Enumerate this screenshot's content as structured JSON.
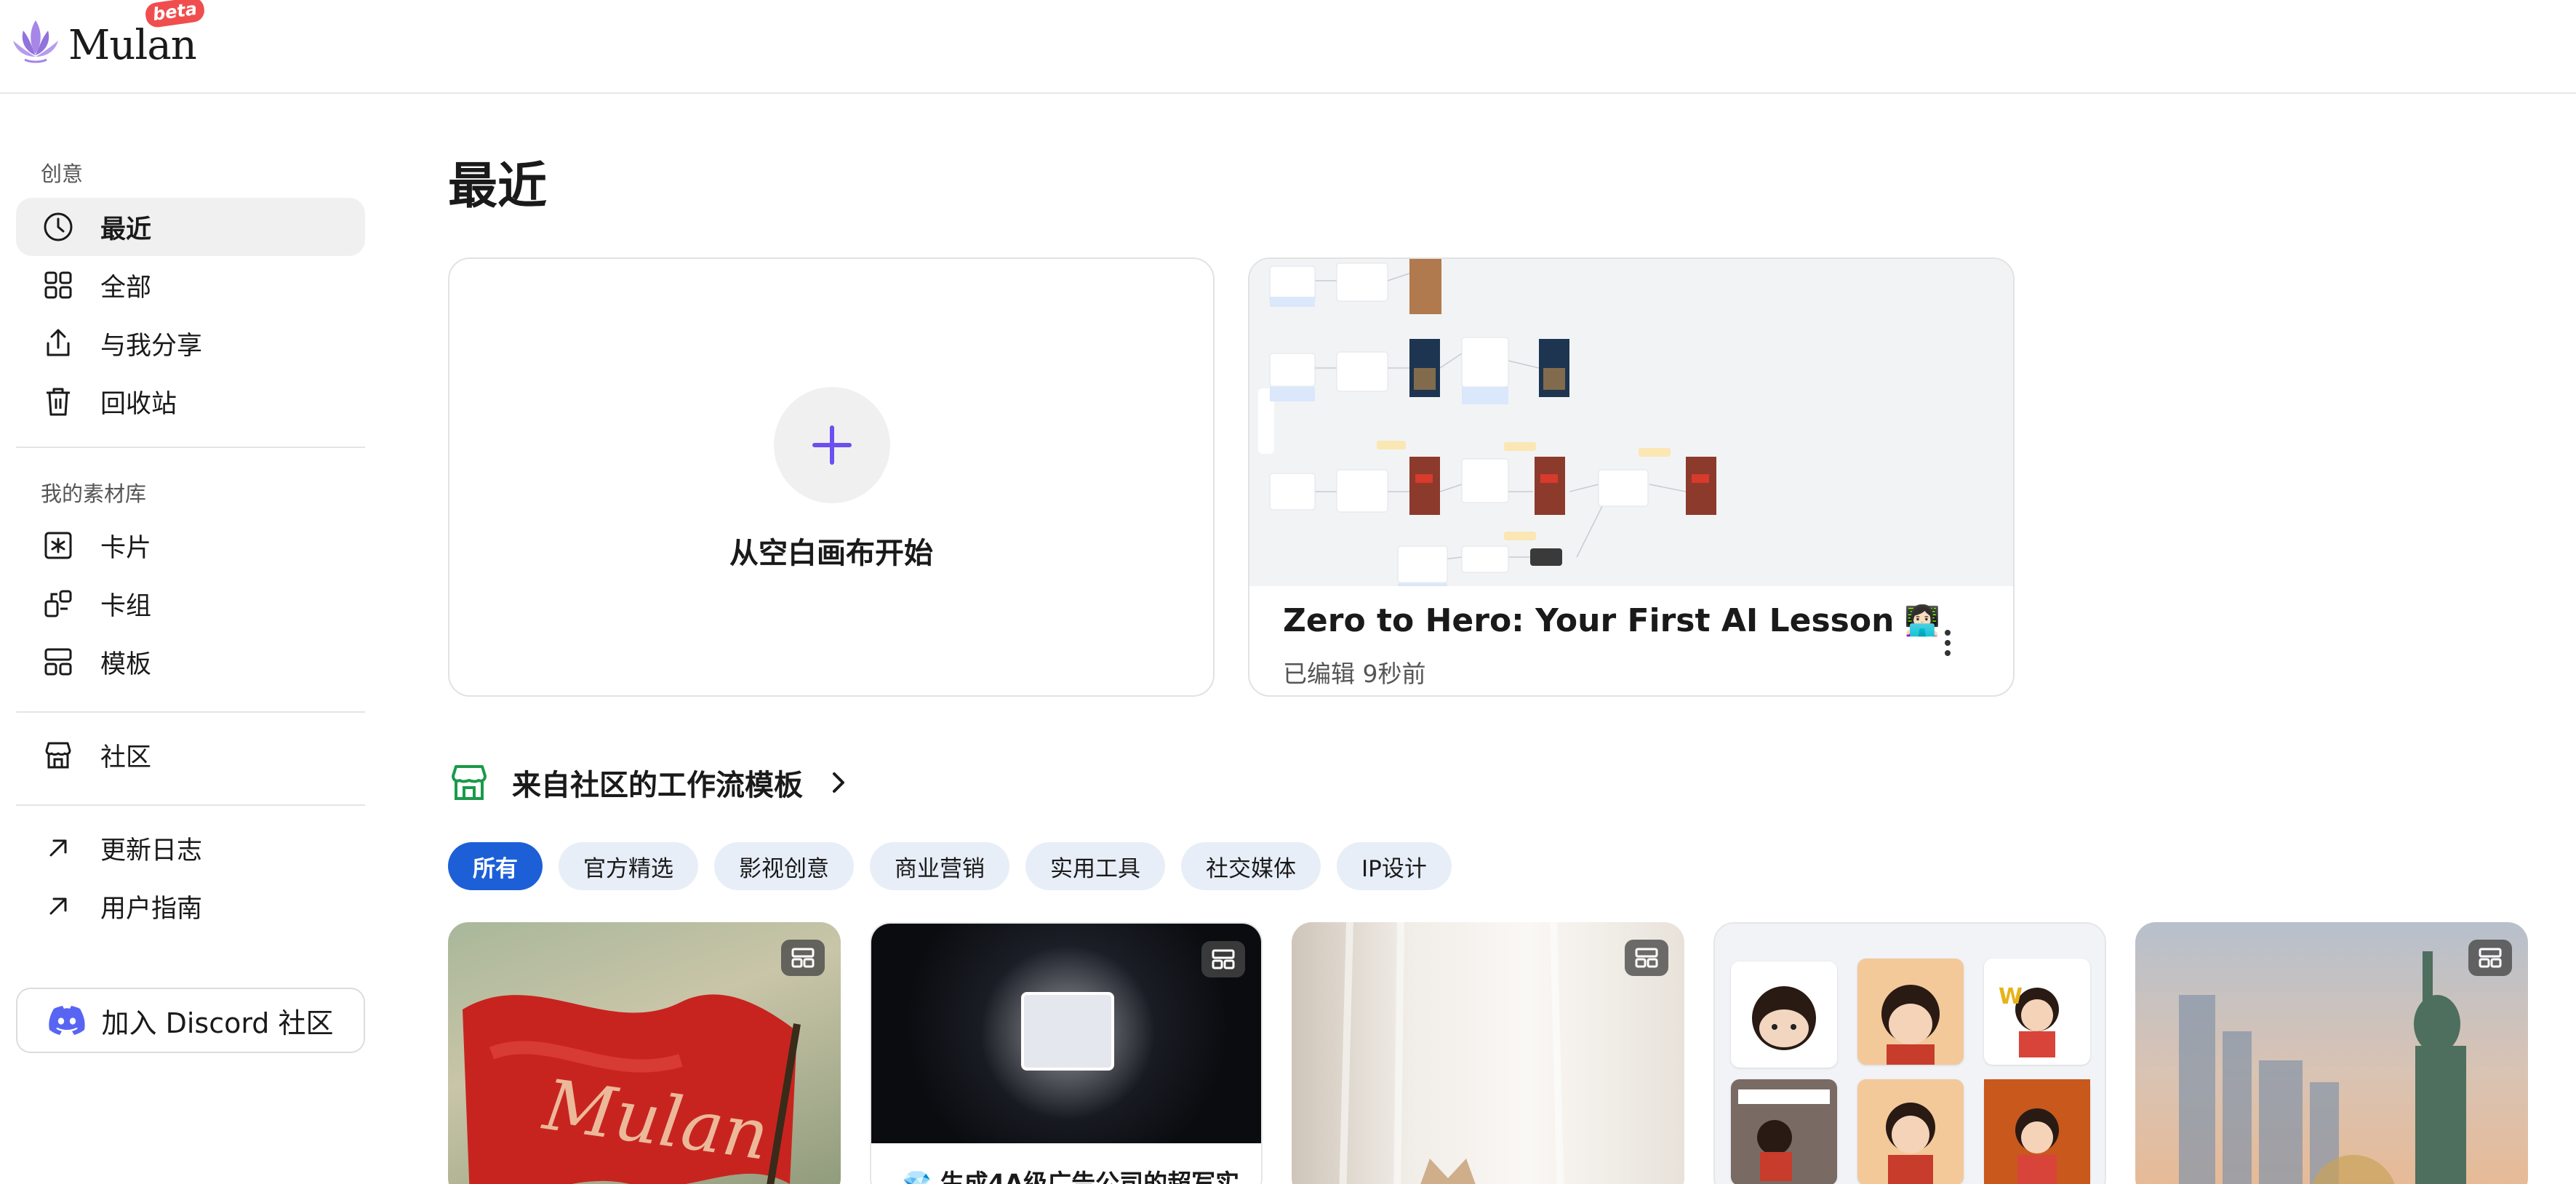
{
  "app": {
    "name": "Mulan",
    "badge": "beta"
  },
  "sidebar": {
    "section_create": "创意",
    "items_create": [
      {
        "label": "最近",
        "icon": "clock-icon",
        "active": true
      },
      {
        "label": "全部",
        "icon": "grid-icon"
      },
      {
        "label": "与我分享",
        "icon": "share-icon"
      },
      {
        "label": "回收站",
        "icon": "trash-icon"
      }
    ],
    "section_library": "我的素材库",
    "items_library": [
      {
        "label": "卡片",
        "icon": "card-asterisk-icon"
      },
      {
        "label": "卡组",
        "icon": "card-group-icon"
      },
      {
        "label": "模板",
        "icon": "template-icon"
      }
    ],
    "items_community": [
      {
        "label": "社区",
        "icon": "store-icon"
      }
    ],
    "items_links": [
      {
        "label": "更新日志",
        "icon": "arrow-up-right-icon"
      },
      {
        "label": "用户指南",
        "icon": "arrow-up-right-icon"
      }
    ],
    "discord_label": "加入 Discord 社区"
  },
  "main": {
    "title": "最近",
    "blank_card_label": "从空白画布开始",
    "project": {
      "title": "Zero to Hero: Your First AI Lesson",
      "emoji": "👩🏻‍💻",
      "meta": "已编辑 9秒前"
    },
    "community": {
      "title": "来自社区的工作流模板",
      "chips": [
        "所有",
        "官方精选",
        "影视创意",
        "商业营销",
        "实用工具",
        "社交媒体",
        "IP设计"
      ],
      "active_chip": 0,
      "flag_text": "Mulan",
      "card2_caption": "💎 生成4A级广告公司的超写实"
    }
  },
  "colors": {
    "accent": "#1d5fd7",
    "plus": "#6b4ff0",
    "discord": "#5865f2",
    "community_icon": "#1a9a4a",
    "beta": "#f04e4e"
  }
}
